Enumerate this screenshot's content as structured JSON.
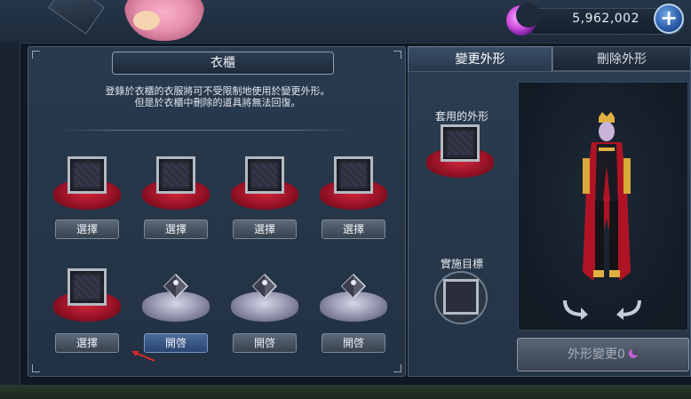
{
  "currency": {
    "value": "5,962,002",
    "add_icon": "+"
  },
  "wardrobe": {
    "title": "衣櫃",
    "notice_line1": "登錄於衣櫃的衣服將可不受限制地使用於變更外形。",
    "notice_line2": "但是於衣櫃中刪除的道具將無法回復。",
    "slots": [
      {
        "state": "empty",
        "button": "選擇"
      },
      {
        "state": "empty",
        "button": "選擇"
      },
      {
        "state": "empty",
        "button": "選擇"
      },
      {
        "state": "empty",
        "button": "選擇"
      },
      {
        "state": "empty",
        "button": "選擇"
      },
      {
        "state": "locked",
        "button": "開啓"
      },
      {
        "state": "locked",
        "button": "開啓"
      },
      {
        "state": "locked",
        "button": "開啓"
      }
    ]
  },
  "appearance": {
    "tabs": [
      {
        "label": "變更外形",
        "active": true
      },
      {
        "label": "刪除外形",
        "active": false
      }
    ],
    "applied_label": "套用的外形",
    "target_label": "實施目標",
    "change_button": "外形變更0"
  },
  "colors": {
    "accent_red": "#d8283e",
    "accent_blue": "#2a5aa8",
    "moon": "#e070e8"
  }
}
